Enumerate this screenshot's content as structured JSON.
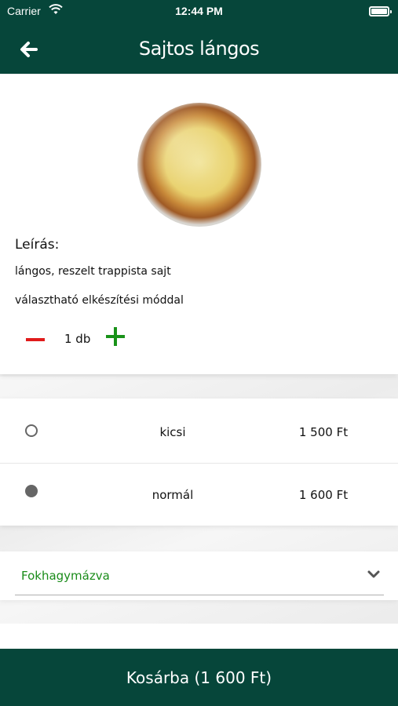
{
  "status_bar": {
    "carrier": "Carrier",
    "time": "12:44 PM"
  },
  "header": {
    "title": "Sajtos lángos",
    "back_icon": "back-arrow-icon"
  },
  "product": {
    "image_icon": "food-photo",
    "description_label": "Leírás:",
    "description_lines": [
      "lángos, reszelt trappista sajt",
      "választható elkészítési móddal"
    ],
    "quantity_text": "1 db"
  },
  "options": [
    {
      "name": "kicsi",
      "price": "1 500 Ft",
      "selected": false
    },
    {
      "name": "normál",
      "price": "1 600 Ft",
      "selected": true
    }
  ],
  "extra_select": {
    "value": "Fokhagymázva",
    "icon": "chevron-down-icon"
  },
  "cart_button": {
    "label": "Kosárba (1 600 Ft)"
  },
  "colors": {
    "brand_green": "#06463a",
    "minus_red": "#e01b1b",
    "plus_green": "#199219",
    "select_text_green": "#1a8c1a"
  }
}
